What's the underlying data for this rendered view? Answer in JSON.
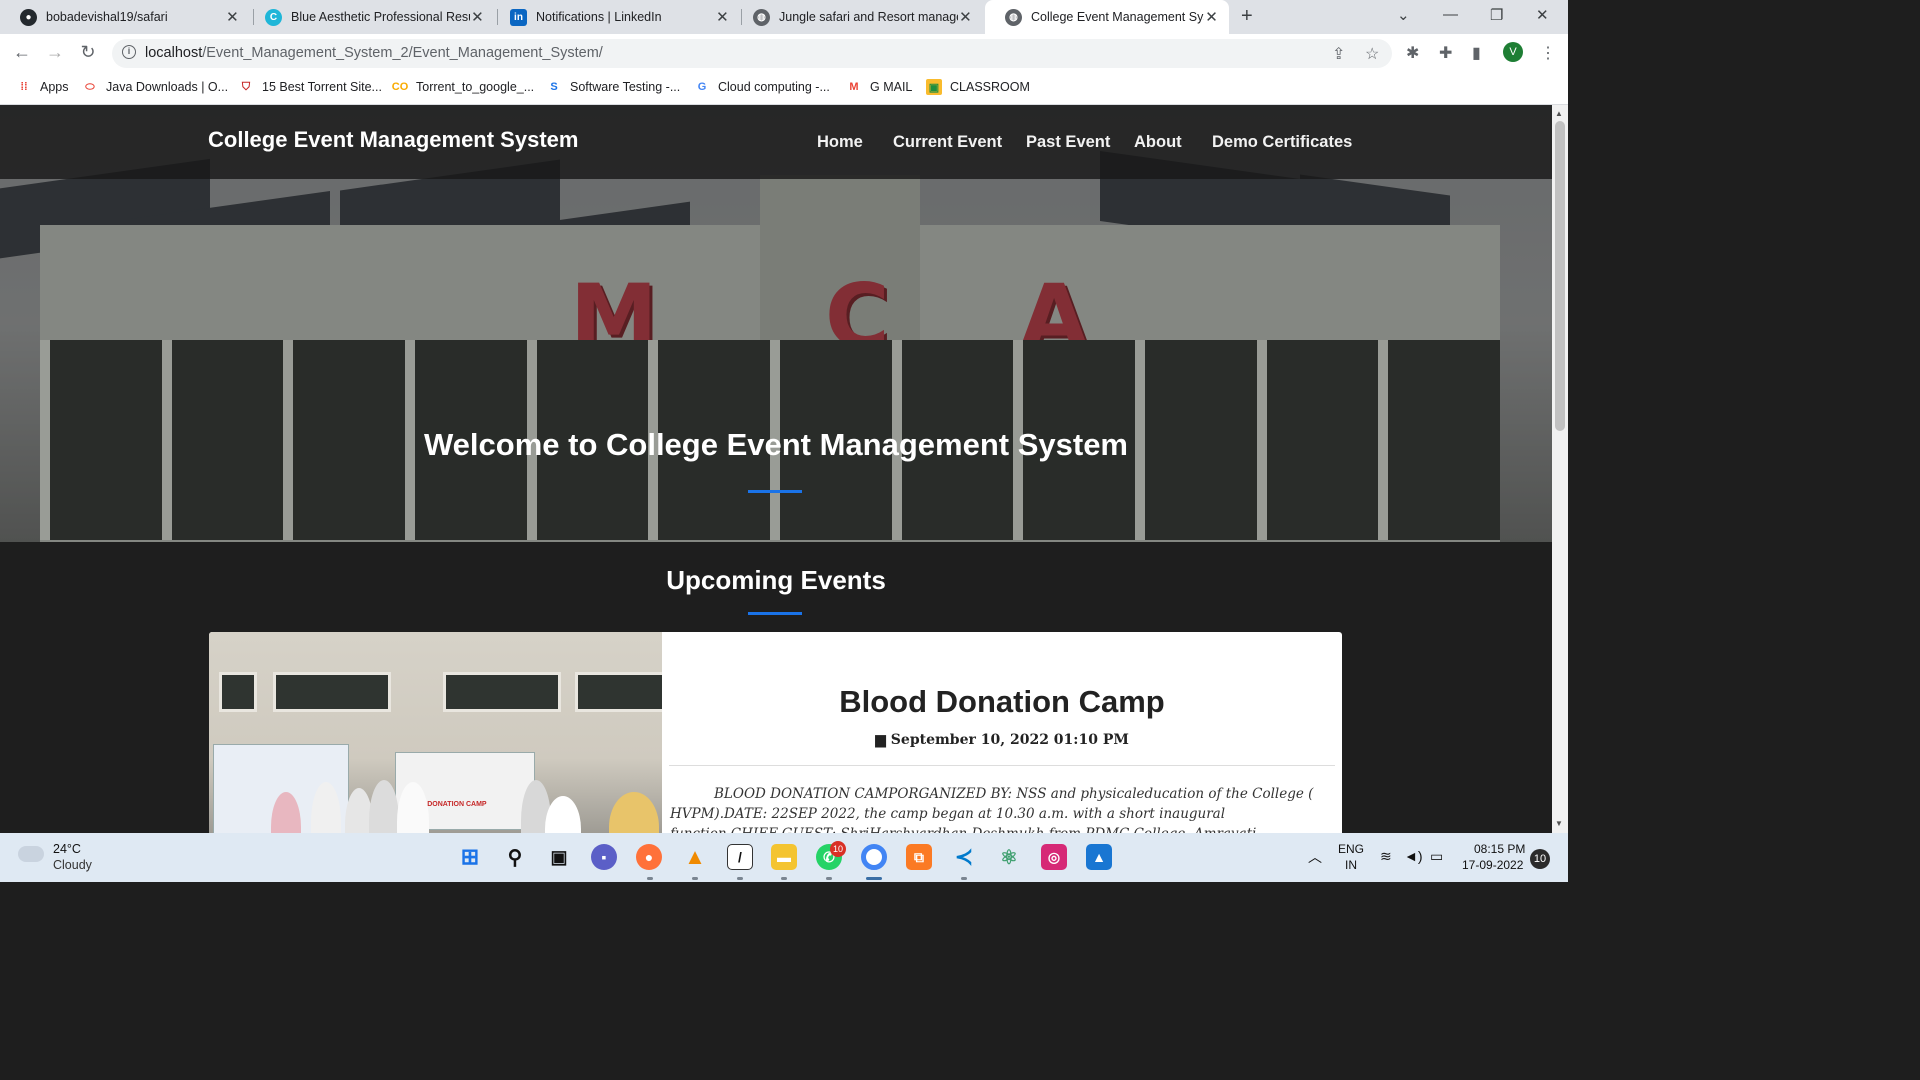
{
  "browser": {
    "tabs": [
      {
        "title": "bobadevishal19/safari",
        "icon": "github-icon"
      },
      {
        "title": "Blue Aesthetic Professional Resum",
        "icon": "canva-icon"
      },
      {
        "title": "Notifications | LinkedIn",
        "icon": "linkedin-icon"
      },
      {
        "title": "Jungle safari and Resort manager",
        "icon": "globe-icon"
      },
      {
        "title": "College Event Management Syste",
        "icon": "globe-icon"
      }
    ],
    "url_host": "localhost",
    "url_path": "/Event_Management_System_2/Event_Management_System/",
    "avatar_letter": "V",
    "bookmarks": [
      {
        "label": "Apps",
        "icon": "apps-grid-icon"
      },
      {
        "label": "Java Downloads | O...",
        "icon": "oracle-icon"
      },
      {
        "label": "15 Best Torrent Site...",
        "icon": "shield-icon"
      },
      {
        "label": "Torrent_to_google_...",
        "icon": "colab-icon"
      },
      {
        "label": "Software Testing -...",
        "icon": "s-icon"
      },
      {
        "label": "Cloud computing -...",
        "icon": "google-icon"
      },
      {
        "label": "G MAIL",
        "icon": "gmail-icon"
      },
      {
        "label": "CLASSROOM",
        "icon": "classroom-icon"
      }
    ]
  },
  "site": {
    "brand": "College Event Management System",
    "nav": [
      "Home",
      "Current Event",
      "Past Event",
      "About",
      "Demo Certificates"
    ],
    "hero_text": "Welcome to College Event Management System",
    "hero_sign_letters": [
      "M",
      "C",
      "A"
    ],
    "section_title": "Upcoming Events",
    "event": {
      "title": "Blood Donation Camp",
      "date": "September 10, 2022 01:10 PM",
      "description": "BLOOD DONATION CAMPORGANIZED BY: NSS and physicaleducation of the College ( HVPM).DATE: 22SEP 2022, the camp began at 10.30 a.m. with a short inaugural function.CHIEF GUEST: ShriHarshvardhan Deshmukh from PDMC College, Amravati Certificate:The blood donors were provided with a blood donatio",
      "photo_banner": "BLOOD DONATION CAMP"
    }
  },
  "taskbar": {
    "temperature": "24°C",
    "condition": "Cloudy",
    "whatsapp_badge": "10",
    "language": "ENG",
    "region": "IN",
    "time": "08:15 PM",
    "date": "17-09-2022",
    "notifications": "10"
  },
  "colors": {
    "accent": "#1a73e8",
    "nav_bg": "#191919",
    "page_bg": "#1e1e1e"
  }
}
